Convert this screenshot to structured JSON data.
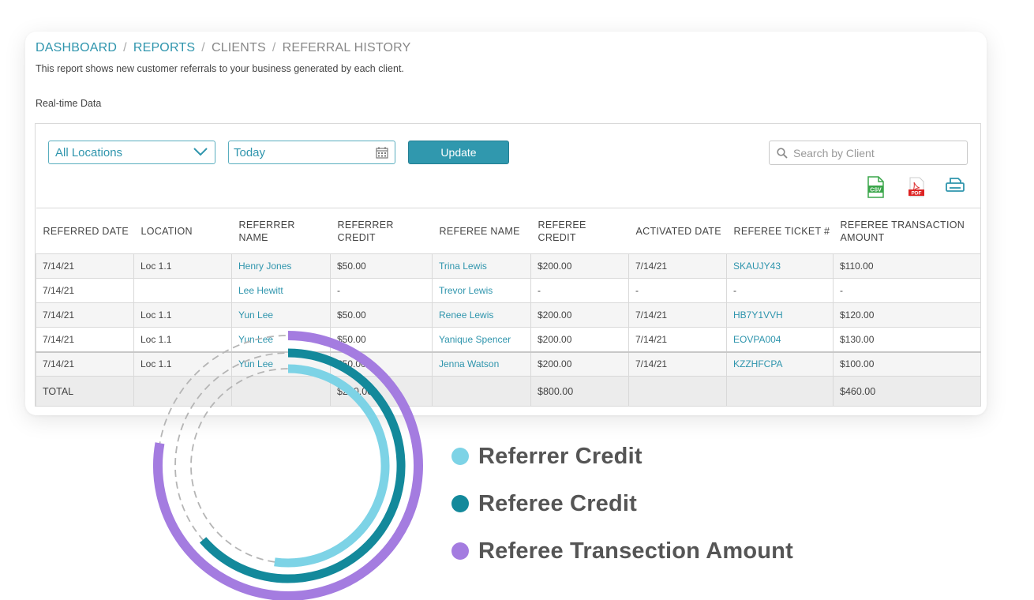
{
  "breadcrumb": {
    "dashboard": "DASHBOARD",
    "reports": "REPORTS",
    "clients": "CLIENTS",
    "current": "REFERRAL HISTORY"
  },
  "description": "This report shows new customer referrals to your business generated by each client.",
  "realtime_label": "Real-time Data",
  "filters": {
    "location_value": "All Locations",
    "date_value": "Today",
    "update_label": "Update",
    "search_placeholder": "Search by Client"
  },
  "export": {
    "csv_label": "CSV",
    "pdf_label": "PDF"
  },
  "table": {
    "headers": [
      "REFERRED DATE",
      "LOCATION",
      "REFERRER NAME",
      "REFERRER CREDIT",
      "REFEREE NAME",
      "REFEREE CREDIT",
      "ACTIVATED DATE",
      "REFEREE TICKET #",
      "REFEREE TRANSACTION AMOUNT"
    ],
    "rows": [
      [
        "7/14/21",
        "Loc 1.1",
        "Henry Jones",
        "$50.00",
        "Trina Lewis",
        "$200.00",
        "7/14/21",
        "SKAUJY43",
        "$110.00"
      ],
      [
        "7/14/21",
        "",
        "Lee Hewitt",
        "-",
        "Trevor Lewis",
        "-",
        "-",
        "-",
        "-"
      ],
      [
        "7/14/21",
        "Loc 1.1",
        "Yun Lee",
        "$50.00",
        "Renee Lewis",
        "$200.00",
        "7/14/21",
        "HB7Y1VVH",
        "$120.00"
      ],
      [
        "7/14/21",
        "Loc 1.1",
        "Yun Lee",
        "$50.00",
        "Yanique Spencer",
        "$200.00",
        "7/14/21",
        "EOVPA004",
        "$130.00"
      ],
      [
        "7/14/21",
        "Loc 1.1",
        "Yun Lee",
        "$50.00",
        "Jenna Watson",
        "$200.00",
        "7/14/21",
        "KZZHFCPA",
        "$100.00"
      ]
    ],
    "total": [
      "TOTAL",
      "",
      "",
      "$200.00",
      "",
      "$800.00",
      "",
      "",
      "$460.00"
    ]
  },
  "legend": {
    "items": [
      {
        "label": "Referrer Credit",
        "color": "#7dd3e6"
      },
      {
        "label": "Referee Credit",
        "color": "#13899b"
      },
      {
        "label": "Referee Transection Amount",
        "color": "#a47ce0"
      }
    ]
  },
  "colors": {
    "link": "#2f95ad",
    "accent_button": "#3098ae",
    "ring_dashed": "#b5b5b5"
  }
}
